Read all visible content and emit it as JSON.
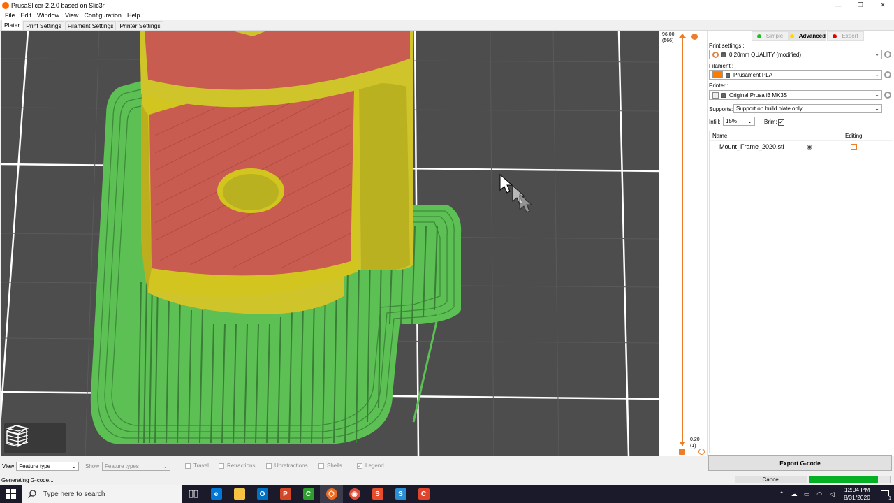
{
  "window": {
    "title": "PrusaSlicer-2.2.0 based on Slic3r",
    "minimize": "—",
    "maximize": "❐",
    "close": "✕"
  },
  "menu": [
    "File",
    "Edit",
    "Window",
    "View",
    "Configuration",
    "Help"
  ],
  "tabs": [
    "Plater",
    "Print Settings",
    "Filament Settings",
    "Printer Settings"
  ],
  "active_tab": "Plater",
  "layer_slider": {
    "top_height": "96.00",
    "top_layer": "(566)",
    "bottom_height": "0.20",
    "bottom_layer": "(1)"
  },
  "mode": {
    "simple": "Simple",
    "advanced": "Advanced",
    "expert": "Expert",
    "active": "Advanced",
    "colors": {
      "simple": "#00b000",
      "advanced": "#ffd800",
      "expert": "#e00000"
    }
  },
  "settings": {
    "print_label": "Print settings :",
    "print_value": "0.20mm QUALITY (modified)",
    "filament_label": "Filament :",
    "filament_value": "Prusament PLA",
    "filament_color": "#ff7b00",
    "printer_label": "Printer :",
    "printer_value": "Original Prusa i3 MK3S",
    "supports_label": "Supports:",
    "supports_value": "Support on build plate only",
    "infill_label": "Infill:",
    "infill_value": "15%",
    "brim_label": "Brim:",
    "brim_checked": "✓"
  },
  "object_list": {
    "col_name": "Name",
    "col_editing": "Editing",
    "items": [
      {
        "name": "Mount_Frame_2020.stl"
      }
    ]
  },
  "bottom_toolbar": {
    "view_label": "View",
    "view_value": "Feature type",
    "show_label": "Show",
    "show_value": "Feature types",
    "travel": "Travel",
    "retractions": "Retractions",
    "unretractions": "Unretractions",
    "shells": "Shells",
    "legend": "Legend",
    "legend_checked": "✓"
  },
  "export_button": "Export G-code",
  "status": {
    "text": "Generating G-code...",
    "cancel": "Cancel",
    "progress": 0.85
  },
  "taskbar": {
    "search_placeholder": "Type here to search",
    "time": "12:04 PM",
    "date": "8/31/2020",
    "notification_count": "1",
    "apps": [
      {
        "icon": "task-view-icon"
      },
      {
        "icon": "edge-icon",
        "color": "#0078d7",
        "glyph": "e"
      },
      {
        "icon": "file-explorer-icon",
        "color": "#f5c242",
        "glyph": ""
      },
      {
        "icon": "outlook-icon",
        "color": "#0072c6",
        "glyph": "O"
      },
      {
        "icon": "powerpoint-icon",
        "color": "#d24726",
        "glyph": "P"
      },
      {
        "icon": "camtasia-icon",
        "color": "#2e9e2e",
        "glyph": "C"
      },
      {
        "icon": "prusaslicer-icon",
        "color": "#ee6a1e",
        "glyph": "⬡"
      },
      {
        "icon": "chrome-icon",
        "color": "#dd4b39",
        "glyph": "◉"
      },
      {
        "icon": "snagit-icon",
        "color": "#e74c2b",
        "glyph": "S"
      },
      {
        "icon": "snagit-editor-icon",
        "color": "#2b8fd6",
        "glyph": "S"
      },
      {
        "icon": "camtasia-recorder-icon",
        "color": "#e0442c",
        "glyph": "C"
      }
    ]
  },
  "colors": {
    "perimeter": "#d4d42a",
    "solid_infill": "#d05a55",
    "support": "#5cc054",
    "bed": "#4d4d4d",
    "grid": "#ffffff"
  }
}
